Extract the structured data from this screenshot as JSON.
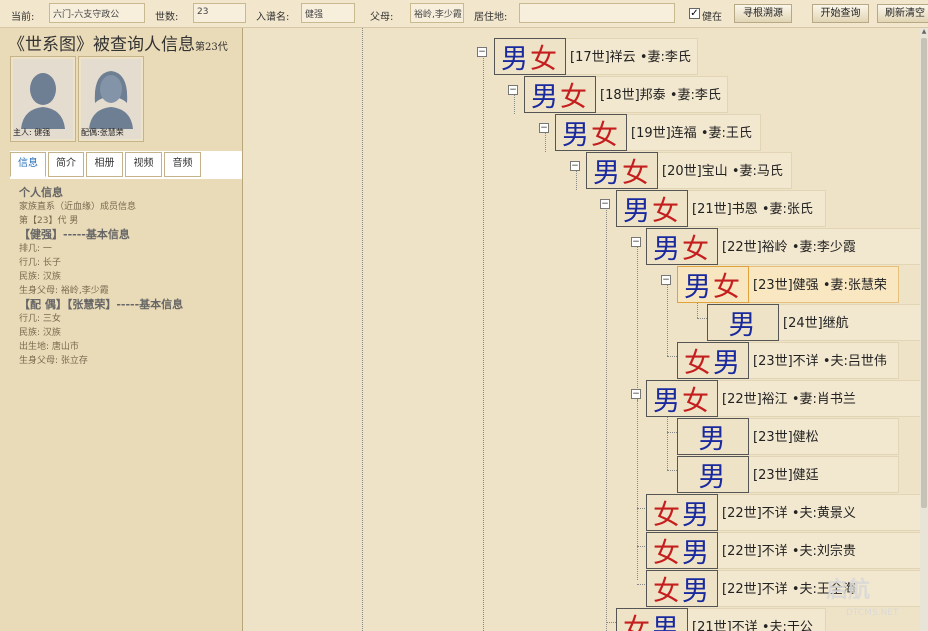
{
  "toolbar": {
    "current_label": "当前:",
    "current_value": "六门-六支守政公",
    "gen_label": "世数:",
    "gen_value": "23",
    "name_label": "入谱名:",
    "name_value": "健强",
    "parents_label": "父母:",
    "parents_value": "裕岭,李少霞",
    "residence_label": "居住地:",
    "residence_value": "",
    "alive_check": "✓",
    "alive_label": "健在",
    "btn_find_root": "寻根溯源",
    "btn_search": "开始查询",
    "btn_refresh": "刷新清空"
  },
  "left": {
    "title": "《世系图》被查询人信息",
    "title_gen": "第23代",
    "host_caption": "主人: 健强",
    "spouse_caption": "配偶:张慧荣",
    "tabs": [
      "信息",
      "简介",
      "相册",
      "视频",
      "音频"
    ],
    "info_lines": [
      {
        "text": "个人信息",
        "h": true
      },
      {
        "text": "家族直系（近血缘）成员信息",
        "h": false
      },
      {
        "text": "第【23】代 男",
        "h": false
      },
      {
        "text": "【健强】-----基本信息",
        "h": true
      },
      {
        "text": "排几: 一",
        "h": false
      },
      {
        "text": "行几: 长子",
        "h": false
      },
      {
        "text": "民族: 汉族",
        "h": false
      },
      {
        "text": "生身父母: 裕岭,李少霞",
        "h": false
      },
      {
        "text": "【配 偶】【张慧荣】-----基本信息",
        "h": true
      },
      {
        "text": "行几: 三女",
        "h": false
      },
      {
        "text": "民族: 汉族",
        "h": false
      },
      {
        "text": "出生地: 唐山市",
        "h": false
      },
      {
        "text": "生身父母: 张立存",
        "h": false
      }
    ]
  },
  "tree": {
    "nodes": [
      {
        "glyphs": [
          "男",
          "女"
        ],
        "text": "[17世]祥云 •妻:李氏"
      },
      {
        "glyphs": [
          "男",
          "女"
        ],
        "text": "[18世]邦泰 •妻:李氏"
      },
      {
        "glyphs": [
          "男",
          "女"
        ],
        "text": "[19世]连福 •妻:王氏"
      },
      {
        "glyphs": [
          "男",
          "女"
        ],
        "text": "[20世]宝山 •妻:马氏"
      },
      {
        "glyphs": [
          "男",
          "女"
        ],
        "text": "[21世]书恩 •妻:张氏"
      },
      {
        "glyphs": [
          "男",
          "女"
        ],
        "text": "[22世]裕岭 •妻:李少霞"
      },
      {
        "glyphs": [
          "男",
          "女"
        ],
        "text": "[23世]健强 •妻:张慧荣",
        "selected": true
      },
      {
        "glyphs": [
          "男"
        ],
        "text": "[24世]继航"
      },
      {
        "glyphs": [
          "女",
          "男"
        ],
        "text": "[23世]不详 •夫:吕世伟"
      },
      {
        "glyphs": [
          "男",
          "女"
        ],
        "text": "[22世]裕江 •妻:肖书兰"
      },
      {
        "glyphs": [
          "男"
        ],
        "text": "[23世]健松"
      },
      {
        "glyphs": [
          "男"
        ],
        "text": "[23世]健廷"
      },
      {
        "glyphs": [
          "女",
          "男"
        ],
        "text": "[22世]不详 •夫:黄景义"
      },
      {
        "glyphs": [
          "女",
          "男"
        ],
        "text": "[22世]不详 •夫:刘宗贵"
      },
      {
        "glyphs": [
          "女",
          "男"
        ],
        "text": "[22世]不详 •夫:王全海"
      },
      {
        "glyphs": [
          "女",
          "男"
        ],
        "text": "[21世]不详 •夫:于公"
      }
    ]
  },
  "watermark": {
    "text": "启航",
    "sub": "DTCMS.NET"
  },
  "colors": {
    "male": "#1a2a9e",
    "female": "#c51e1e",
    "background": "#efe3c7"
  }
}
